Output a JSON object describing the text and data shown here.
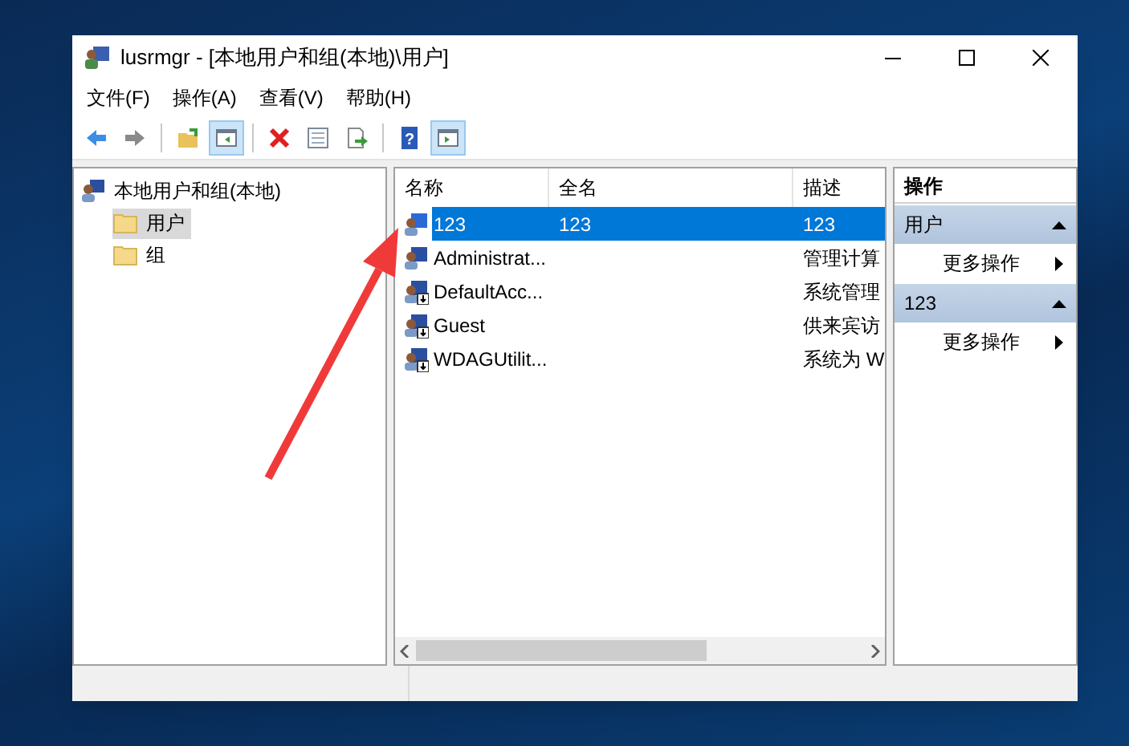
{
  "window": {
    "title": "lusrmgr - [本地用户和组(本地)\\用户]"
  },
  "menu": [
    {
      "label": "文件(F)"
    },
    {
      "label": "操作(A)"
    },
    {
      "label": "查看(V)"
    },
    {
      "label": "帮助(H)"
    }
  ],
  "toolbar": [
    {
      "kind": "back",
      "pressed": false
    },
    {
      "kind": "forward",
      "pressed": false
    },
    {
      "kind": "sep"
    },
    {
      "kind": "up",
      "pressed": false
    },
    {
      "kind": "tree",
      "pressed": true
    },
    {
      "kind": "sep"
    },
    {
      "kind": "delete",
      "pressed": false
    },
    {
      "kind": "properties",
      "pressed": false
    },
    {
      "kind": "export",
      "pressed": false
    },
    {
      "kind": "sep"
    },
    {
      "kind": "help",
      "pressed": false,
      "symbol": "?"
    },
    {
      "kind": "actionpane",
      "pressed": true
    }
  ],
  "tree": [
    {
      "label": "本地用户和组(本地)",
      "kind": "computer",
      "selected": false,
      "children": [
        {
          "label": "用户",
          "kind": "folder",
          "selected": true
        },
        {
          "label": "组",
          "kind": "folder",
          "selected": false
        }
      ]
    }
  ],
  "table": {
    "columns": [
      "名称",
      "全名",
      "描述"
    ],
    "rows": [
      {
        "name": "123",
        "full_name": "123",
        "description": "123",
        "selected": true,
        "disabled": false
      },
      {
        "name": "Administrat...",
        "description": "管理计算",
        "selected": false,
        "disabled": false
      },
      {
        "name": "DefaultAcc...",
        "description": "系统管理",
        "selected": false,
        "disabled": true
      },
      {
        "name": "Guest",
        "description": "供来宾访",
        "selected": false,
        "disabled": true
      },
      {
        "name": "WDAGUtilit...",
        "description": "系统为 W",
        "selected": false,
        "disabled": true
      }
    ]
  },
  "actions": {
    "title": "操作",
    "sections": [
      {
        "title": "用户",
        "expanded": true,
        "items": [
          "更多操作"
        ]
      },
      {
        "title": "123",
        "expanded": true,
        "items": [
          "更多操作"
        ]
      }
    ]
  }
}
